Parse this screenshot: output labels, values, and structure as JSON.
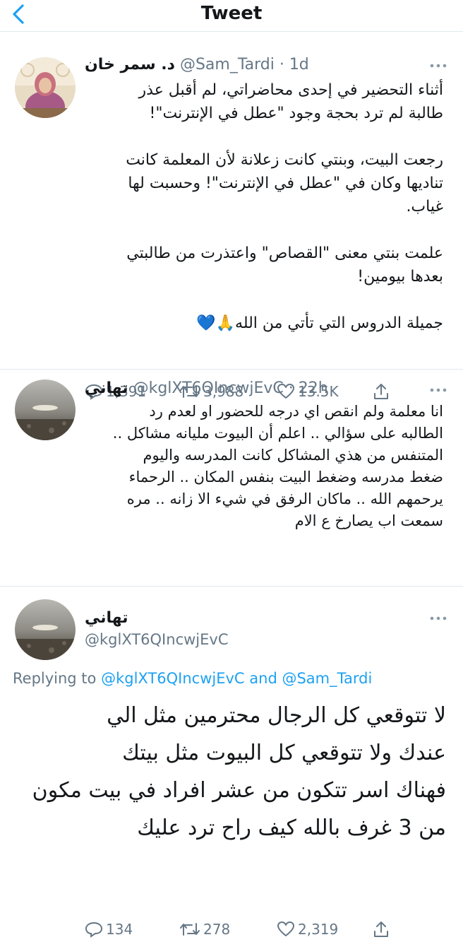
{
  "nav": {
    "title": "Tweet"
  },
  "tweet1": {
    "name": "د. سمر خان",
    "handle": "@Sam_Tardi",
    "time": "· 1d",
    "paragraphs": [
      [
        "أثناء التحضير في إحدى محاضراتي، لم أقبل عذر",
        "طالبة لم ترد بحجة وجود \"عطل في الإنترنت\"!"
      ],
      [
        "رجعت البيت، وبنتي كانت زعلانة لأن المعلمة كانت",
        "تناديها وكان في \"عطل في الإنترنت\"! وحسبت لها",
        "غياب."
      ],
      [
        "علمت بنتي معنى \"القصاص\" واعتذرت من طالبتي",
        "بعدها بيومين!"
      ],
      [
        "جميلة الدروس التي تأتي من الله🙏💙"
      ]
    ],
    "stats": {
      "replies": "1,391",
      "retweets": "3,988",
      "likes": "13.5K"
    }
  },
  "tweet2": {
    "name": "تهاني",
    "handle": "@kglXT6QIncwjEvC",
    "time": "· 22h",
    "lines": [
      "انا معلمة ولم انقص اي درجه للحضور او لعدم رد",
      "الطالبه على سؤالي .. اعلم أن البيوت مليانه مشاكل ..",
      "المتنفس من هذي المشاكل كانت المدرسه واليوم",
      "ضغط مدرسه وضغط البيت بنفس المكان .. الرحماء",
      "يرحمهم الله .. ماكان الرفق في شيء الا زانه .. مره",
      "سمعت اب يصارخ ع الام"
    ],
    "stats": {
      "replies": "134",
      "retweets": "278",
      "likes": "2,319"
    }
  },
  "tweet3": {
    "name": "تهاني",
    "handle": "@kglXT6QIncwjEvC",
    "replying_prefix": "Replying to",
    "replying_to_1": "@kglXT6QIncwjEvC",
    "replying_and": "and",
    "replying_to_2": "@Sam_Tardi",
    "lines": [
      "لا تتوقعي  كل الرجال محترمين مثل الي",
      "عندك  ولا تتوقعي كل البيوت مثل بيتك",
      "فهناك اسر تتكون من عشر افراد في بيت مكون",
      "من 3 غرف بالله كيف راح ترد عليك"
    ]
  },
  "colors": {
    "accent": "#1da1f2",
    "secondary_text": "#657786",
    "divider": "#e1e8ed"
  }
}
